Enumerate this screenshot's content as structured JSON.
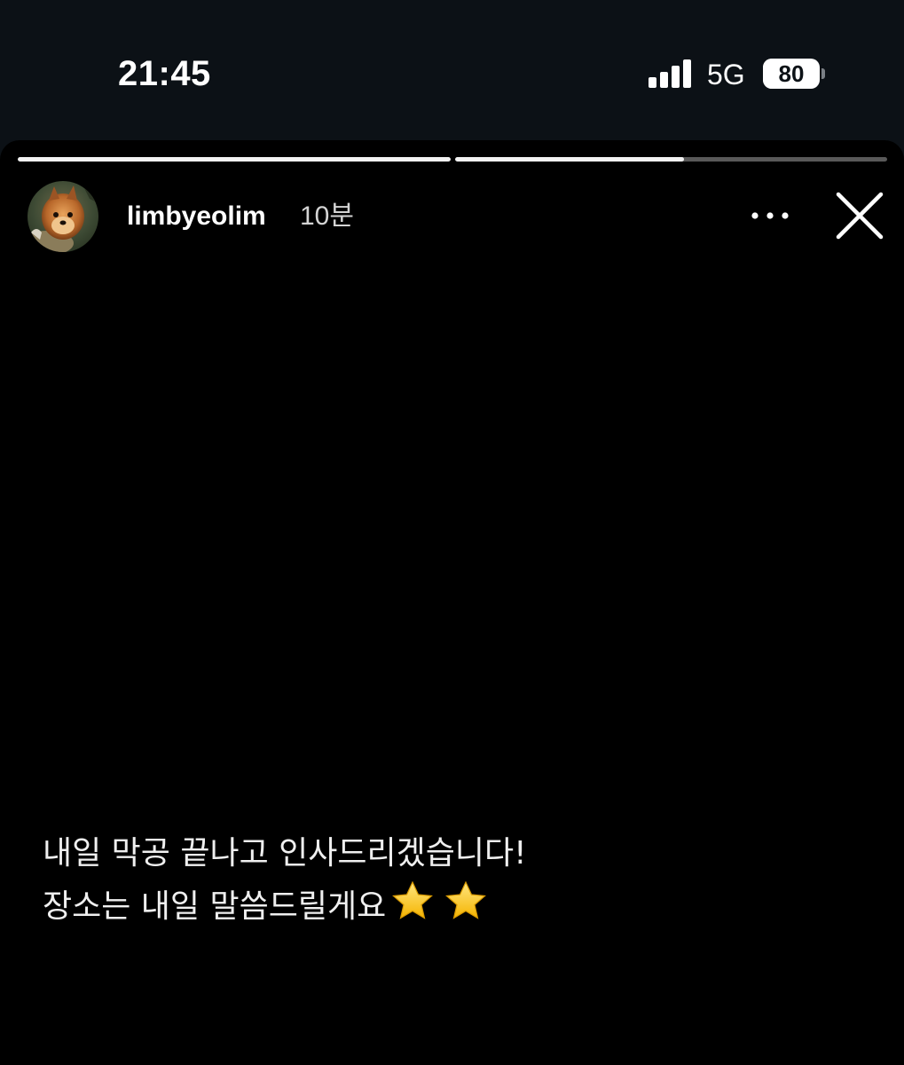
{
  "status_bar": {
    "time": "21:45",
    "network": "5G",
    "battery": "80",
    "battery_level": 80,
    "signal_icon": "cellular-signal-icon"
  },
  "story": {
    "progress_segments": [
      {
        "progress": 1.0
      },
      {
        "progress": 0.53
      }
    ],
    "header": {
      "avatar_icon": "profile-avatar",
      "username": "limbyeolim",
      "time_ago": "10분",
      "more_icon": "more-horizontal-icon",
      "close_icon": "close-icon"
    },
    "caption": {
      "line1": "내일 막공 끝나고 인사드리겠습니다!",
      "line2": "장소는 내일 말씀드릴게요",
      "emoji": "star-emoji-icon"
    }
  }
}
